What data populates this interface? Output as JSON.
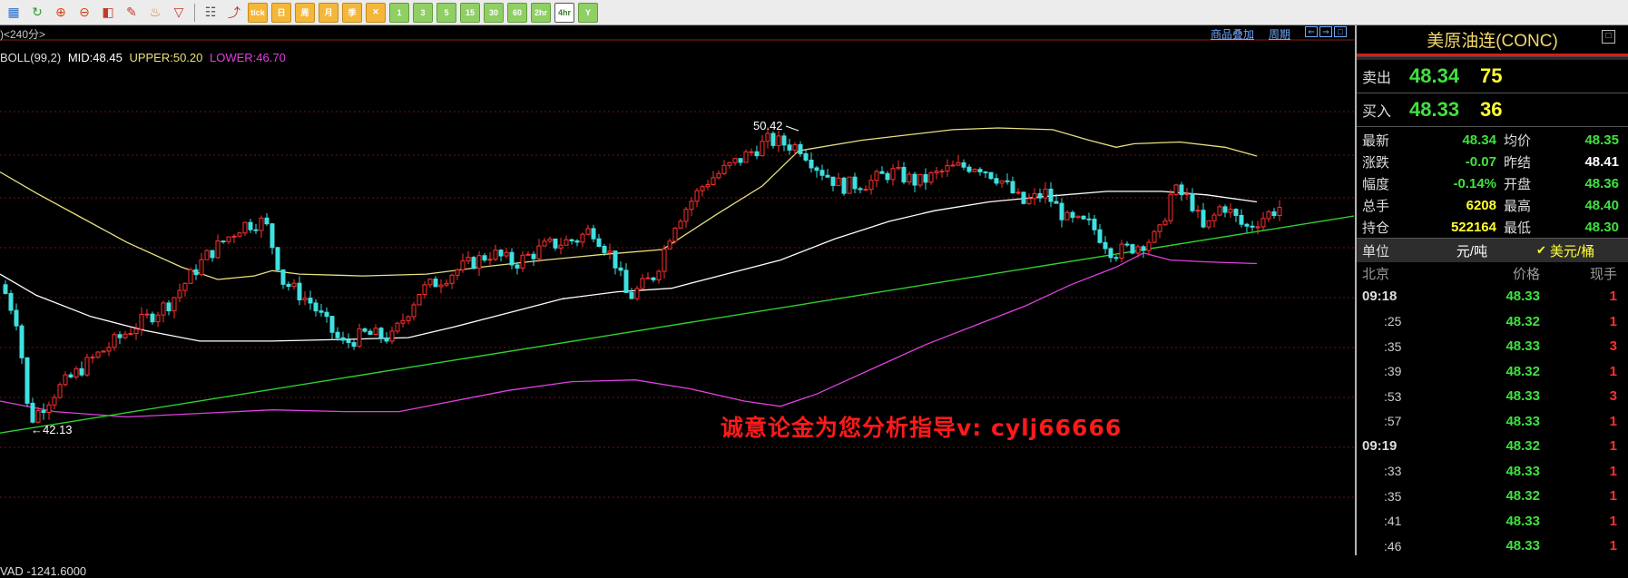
{
  "toolbar": {
    "buttons": [
      {
        "name": "grid-icon",
        "glyph": "▦",
        "kind": "ico",
        "color": "#2a6fc9"
      },
      {
        "name": "refresh-icon",
        "glyph": "↻",
        "kind": "ico",
        "color": "#2e9b2e"
      },
      {
        "name": "zoom-in-icon",
        "glyph": "⊕",
        "kind": "ico",
        "color": "#d2421c"
      },
      {
        "name": "zoom-out-icon",
        "glyph": "⊖",
        "kind": "ico",
        "color": "#d2421c"
      },
      {
        "name": "window-icon",
        "glyph": "◧",
        "kind": "ico",
        "color": "#c0392b"
      },
      {
        "name": "pen-icon",
        "glyph": "✎",
        "kind": "ico",
        "color": "#c0392b"
      },
      {
        "name": "brush-icon",
        "glyph": "♨",
        "kind": "ico",
        "color": "#e07b1a"
      },
      {
        "name": "filter-icon",
        "glyph": "▽",
        "kind": "ico",
        "color": "#c0392b"
      },
      {
        "kind": "sep"
      },
      {
        "name": "table-icon",
        "glyph": "☷",
        "kind": "ico",
        "color": "#555555"
      },
      {
        "name": "trend-icon",
        "glyph": "⤴",
        "kind": "ico",
        "color": "#c0392b"
      },
      {
        "name": "tick-button",
        "label": "tick",
        "kind": "period"
      },
      {
        "name": "day-button",
        "label": "日",
        "kind": "period"
      },
      {
        "name": "week-button",
        "label": "周",
        "kind": "period"
      },
      {
        "name": "month-button",
        "label": "月",
        "kind": "period"
      },
      {
        "name": "quarter-button",
        "label": "季",
        "kind": "period"
      },
      {
        "name": "multi-period-button",
        "label": "✕",
        "kind": "period"
      },
      {
        "name": "min1-button",
        "label": "1",
        "kind": "num"
      },
      {
        "name": "min3-button",
        "label": "3",
        "kind": "num"
      },
      {
        "name": "min5-button",
        "label": "5",
        "kind": "num"
      },
      {
        "name": "min15-button",
        "label": "15",
        "kind": "num"
      },
      {
        "name": "min30-button",
        "label": "30",
        "kind": "num"
      },
      {
        "name": "min60-button",
        "label": "60",
        "kind": "num"
      },
      {
        "name": "hour2-button",
        "label": "2hr",
        "kind": "num"
      },
      {
        "name": "hour4-button",
        "label": "4hr",
        "kind": "active"
      },
      {
        "name": "year-button",
        "label": "Y",
        "kind": "num"
      }
    ]
  },
  "chart": {
    "period_label": ")<240分>",
    "link_overlay": "商品叠加",
    "link_period": "周期",
    "nav_buttons": [
      "⇐",
      "⇒",
      "□"
    ],
    "boll_name": "BOLL(99,2)",
    "boll_mid": "MID:48.45",
    "boll_upper": "UPPER:50.20",
    "boll_lower": "LOWER:46.70",
    "boll_colors": {
      "mid": "#ffffff",
      "upper": "#e8e080",
      "lower": "#e040e0"
    },
    "high_label": "50.42",
    "low_label": "←42.13",
    "vad_label": "VAD  -1241.6000",
    "watermark": "诚意论金为您分析指导v: cylj66666",
    "candle_up": "#ff3030",
    "candle_down": "#40e0e0",
    "trendline_color": "#30d030"
  },
  "chart_data": {
    "type": "candlestick",
    "indicator": "BOLL(99,2)",
    "visible_range": {
      "low": 42.13,
      "high": 50.42
    },
    "last": {
      "mid": 48.45,
      "upper": 50.2,
      "lower": 46.7
    }
  },
  "panel": {
    "title": "美原油连(CONC)",
    "close_glyph": "□",
    "ask_label": "卖出",
    "ask_price": "48.34",
    "ask_vol": "75",
    "bid_label": "买入",
    "bid_price": "48.33",
    "bid_vol": "36",
    "info": [
      {
        "l": "最新",
        "v": "48.34",
        "vc": "c-green",
        "l2": "均价",
        "v2": "48.35",
        "v2c": "c-green"
      },
      {
        "l": "涨跌",
        "v": "-0.07",
        "vc": "c-green",
        "l2": "昨结",
        "v2": "48.41",
        "v2c": "c-white"
      },
      {
        "l": "幅度",
        "v": "-0.14%",
        "vc": "c-green",
        "l2": "开盘",
        "v2": "48.36",
        "v2c": "c-green"
      },
      {
        "l": "总手",
        "v": "6208",
        "vc": "c-yellow",
        "l2": "最高",
        "v2": "48.40",
        "v2c": "c-green"
      },
      {
        "l": "持仓",
        "v": "522164",
        "vc": "c-yellow",
        "l2": "最低",
        "v2": "48.30",
        "v2c": "c-green"
      }
    ],
    "unit_label": "单位",
    "unit_value": "元/吨",
    "unit_check": "✔",
    "unit_value2": "美元/桶",
    "tick_head": {
      "time": "北京",
      "price": "价格",
      "qty": "现手"
    },
    "ticks": [
      {
        "t": "09:18",
        "p": "48.33",
        "q": "1",
        "sub": false
      },
      {
        "t": ":25",
        "p": "48.32",
        "q": "1",
        "sub": true
      },
      {
        "t": ":35",
        "p": "48.33",
        "q": "3",
        "sub": true
      },
      {
        "t": ":39",
        "p": "48.32",
        "q": "1",
        "sub": true
      },
      {
        "t": ":53",
        "p": "48.33",
        "q": "3",
        "sub": true
      },
      {
        "t": ":57",
        "p": "48.33",
        "q": "1",
        "sub": true
      },
      {
        "t": "09:19",
        "p": "48.32",
        "q": "1",
        "sub": false
      },
      {
        "t": ":33",
        "p": "48.33",
        "q": "1",
        "sub": true
      },
      {
        "t": ":35",
        "p": "48.32",
        "q": "1",
        "sub": true
      },
      {
        "t": ":41",
        "p": "48.33",
        "q": "1",
        "sub": true
      },
      {
        "t": ":46",
        "p": "48.33",
        "q": "1",
        "sub": true
      }
    ]
  }
}
